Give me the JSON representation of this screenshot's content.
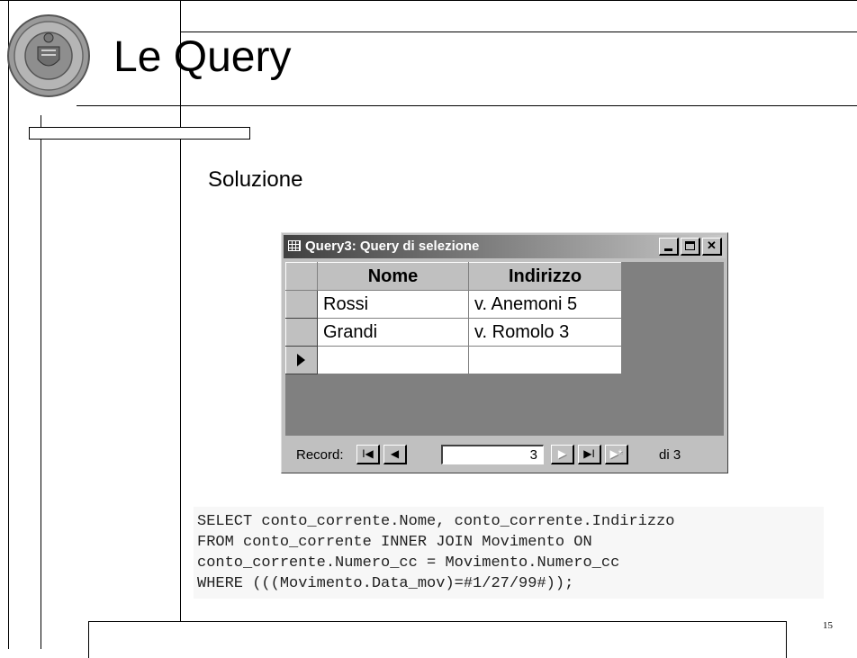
{
  "slide": {
    "title": "Le Query",
    "subtitle": "Soluzione",
    "page_number": "15"
  },
  "query_window": {
    "title": "Query3: Query di selezione",
    "columns": [
      "Nome",
      "Indirizzo"
    ],
    "rows": [
      [
        "Rossi",
        "v. Anemoni 5"
      ],
      [
        "Grandi",
        "v. Romolo 3"
      ],
      [
        "",
        ""
      ]
    ],
    "navigation": {
      "label": "Record:",
      "current_record": "3",
      "total": "di 3"
    }
  },
  "sql": {
    "lines": [
      "SELECT conto_corrente.Nome, conto_corrente.Indirizzo",
      "FROM conto_corrente INNER JOIN Movimento ON",
      "conto_corrente.Numero_cc = Movimento.Numero_cc",
      "WHERE (((Movimento.Data_mov)=#1/27/99#));"
    ]
  },
  "colors": {
    "window_face": "#c0c0c0",
    "grid_background": "#808080",
    "sql_background": "#f7f7f7"
  }
}
